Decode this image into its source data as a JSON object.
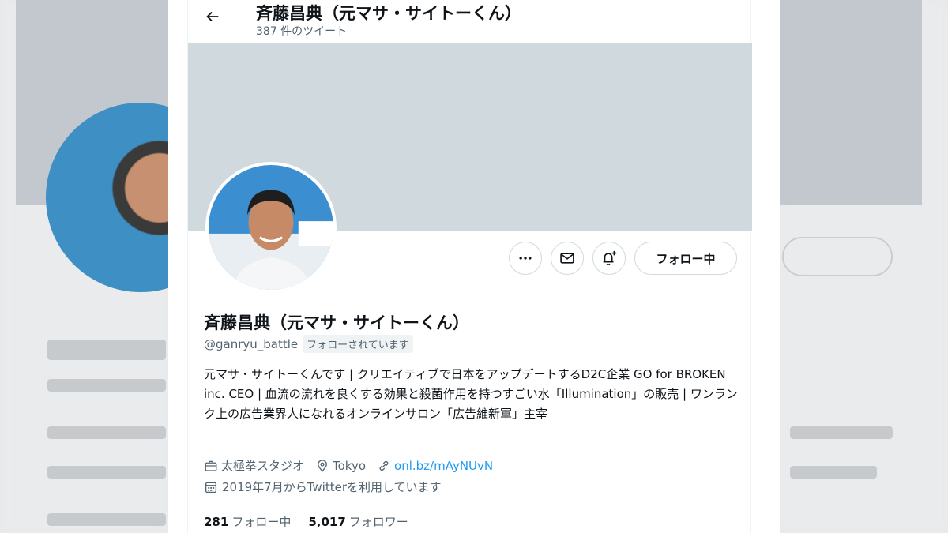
{
  "header": {
    "title": "斉藤昌典（元マサ・サイトーくん）",
    "tweet_count": "387 件のツイート"
  },
  "profile": {
    "name": "斉藤昌典（元マサ・サイトーくん）",
    "handle": "@ganryu_battle",
    "follows_you": "フォローされています",
    "bio": "元マサ・サイトーくんです | クリエイティブで日本をアップデートするD2C企業 GO for BROKEN inc. CEO | 血流の流れを良くする効果と殺菌作用を持つすごい水「Illumination」の販売 | ワンランク上の広告業界人になれるオンラインサロン「広告維新軍」主宰",
    "work": "太極拳スタジオ",
    "location": "Tokyo",
    "url": "onl.bz/mAyNUvN",
    "joined": "2019年7月からTwitterを利用しています"
  },
  "actions": {
    "follow_label": "フォロー中"
  },
  "stats": {
    "following_count": "281",
    "following_label": "フォロー中",
    "followers_count": "5,017",
    "followers_label": "フォロワー"
  },
  "colors": {
    "banner": "#cfd9de",
    "link": "#1d9bf0",
    "secondary_text": "#536471"
  },
  "icons": [
    "back-arrow-icon",
    "more-icon",
    "mail-icon",
    "notification-add-icon",
    "briefcase-icon",
    "location-pin-icon",
    "link-icon",
    "calendar-icon"
  ]
}
